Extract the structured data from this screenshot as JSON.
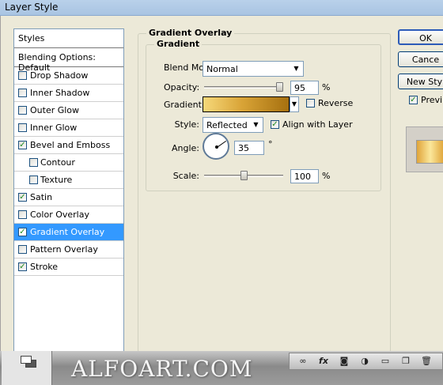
{
  "window": {
    "title": "Layer Style"
  },
  "style_list": {
    "header": "Styles",
    "blending": "Blending Options: Default",
    "items": [
      {
        "label": "Drop Shadow",
        "checked": false,
        "indent": false,
        "active": false
      },
      {
        "label": "Inner Shadow",
        "checked": false,
        "indent": false,
        "active": false
      },
      {
        "label": "Outer Glow",
        "checked": false,
        "indent": false,
        "active": false
      },
      {
        "label": "Inner Glow",
        "checked": false,
        "indent": false,
        "active": false
      },
      {
        "label": "Bevel and Emboss",
        "checked": true,
        "indent": false,
        "active": false
      },
      {
        "label": "Contour",
        "checked": false,
        "indent": true,
        "active": false
      },
      {
        "label": "Texture",
        "checked": false,
        "indent": true,
        "active": false
      },
      {
        "label": "Satin",
        "checked": true,
        "indent": false,
        "active": false
      },
      {
        "label": "Color Overlay",
        "checked": false,
        "indent": false,
        "active": false
      },
      {
        "label": "Gradient Overlay",
        "checked": true,
        "indent": false,
        "active": true
      },
      {
        "label": "Pattern Overlay",
        "checked": false,
        "indent": false,
        "active": false
      },
      {
        "label": "Stroke",
        "checked": true,
        "indent": false,
        "active": false
      }
    ]
  },
  "panel": {
    "group_title": "Gradient Overlay",
    "sub_title": "Gradient",
    "blend_mode": {
      "label": "Blend Mode:",
      "value": "Normal"
    },
    "opacity": {
      "label": "Opacity:",
      "value": "95",
      "unit": "%",
      "level": 0.95
    },
    "gradient": {
      "label": "Gradient:",
      "reverse_label": "Reverse",
      "reverse_checked": false
    },
    "style": {
      "label": "Style:",
      "value": "Reflected",
      "align_label": "Align with Layer",
      "align_checked": true
    },
    "angle": {
      "label": "Angle:",
      "value": "35",
      "unit": "°"
    },
    "scale": {
      "label": "Scale:",
      "value": "100",
      "unit": "%",
      "level": 0.5
    }
  },
  "buttons": {
    "ok": "OK",
    "cancel": "Cance",
    "new_style": "New Styl",
    "preview": "Previ"
  },
  "preview_checked": true,
  "watermark": "ALFOART.COM",
  "colors": {
    "highlight": "#3399ff",
    "gradient_start": "#f6d87a",
    "gradient_end": "#a6700f"
  },
  "icons": [
    "link-icon",
    "fx-icon",
    "mask-icon",
    "adjustment-icon",
    "folder-icon",
    "new-layer-icon",
    "trash-icon"
  ]
}
